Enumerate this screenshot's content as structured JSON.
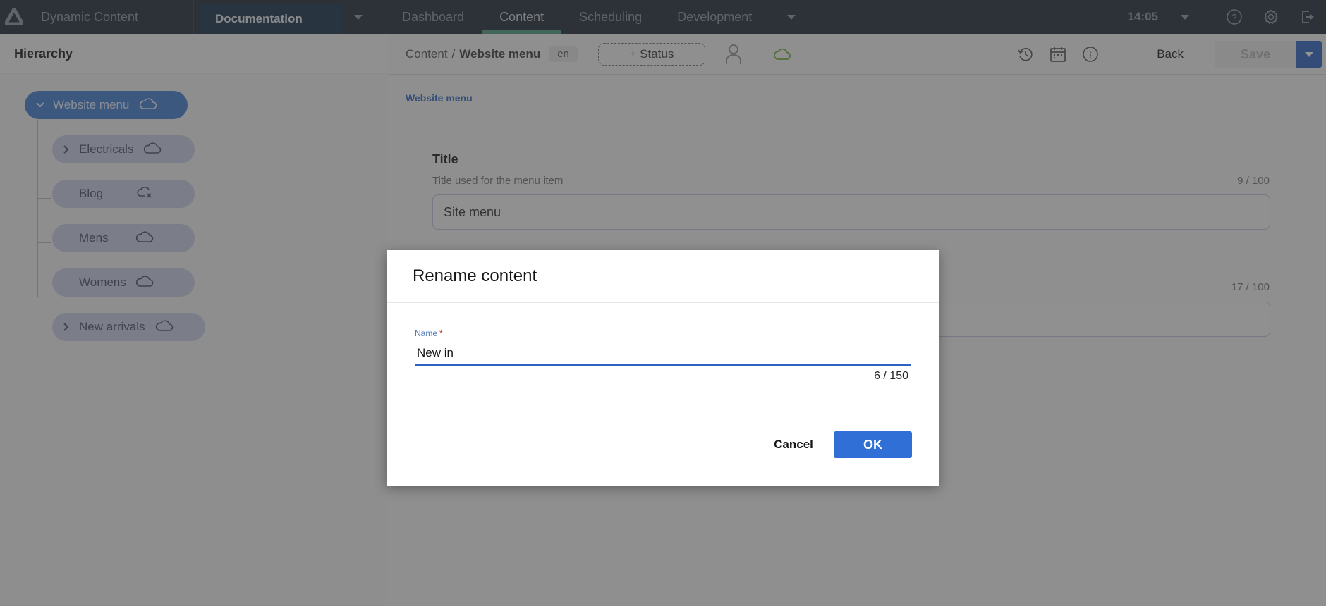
{
  "topnav": {
    "app_name": "Dynamic Content",
    "hub": "Documentation",
    "tabs": [
      {
        "label": "Dashboard",
        "active": false
      },
      {
        "label": "Content",
        "active": true
      },
      {
        "label": "Scheduling",
        "active": false
      },
      {
        "label": "Development",
        "active": false
      }
    ],
    "clock": "14:05",
    "icons": [
      "help-icon",
      "settings-icon",
      "logout-icon"
    ]
  },
  "hierarchy": {
    "title": "Hierarchy",
    "root": {
      "label": "Website menu",
      "expanded": true,
      "status_icon": "cloud-icon"
    },
    "children": [
      {
        "label": "Electricals",
        "has_children": true,
        "status_icon": "cloud-icon"
      },
      {
        "label": "Blog",
        "has_children": false,
        "status_icon": "cloud-off-icon"
      },
      {
        "label": "Mens",
        "has_children": false,
        "status_icon": "cloud-icon"
      },
      {
        "label": "Womens",
        "has_children": false,
        "status_icon": "cloud-icon"
      },
      {
        "label": "New arrivals",
        "has_children": true,
        "status_icon": "cloud-icon"
      }
    ]
  },
  "toolbar": {
    "breadcrumb_root": "Content",
    "breadcrumb_sep": "/",
    "breadcrumb_current": "Website menu",
    "locale": "en",
    "status_button": "+ Status",
    "back_label": "Back",
    "save_label": "Save",
    "publish_status_color": "#5a9a2a"
  },
  "form": {
    "section_link": "Website menu",
    "fields": [
      {
        "label": "Title",
        "help": "Title used for the menu item",
        "count": "9 / 100",
        "value": "Site menu"
      },
      {
        "label": "",
        "help": "",
        "count": "17 / 100",
        "value": ""
      }
    ]
  },
  "modal": {
    "title": "Rename content",
    "name_label": "Name",
    "required_mark": "*",
    "name_value": "New in",
    "name_count": "6 / 150",
    "cancel_label": "Cancel",
    "ok_label": "OK"
  },
  "colors": {
    "nav_bg": "#1b2633",
    "accent_blue": "#2f6fd6",
    "active_tab_indicator": "#4a9a7a",
    "tree_root": "#3f7ad0",
    "tree_child": "#c8cde6"
  }
}
